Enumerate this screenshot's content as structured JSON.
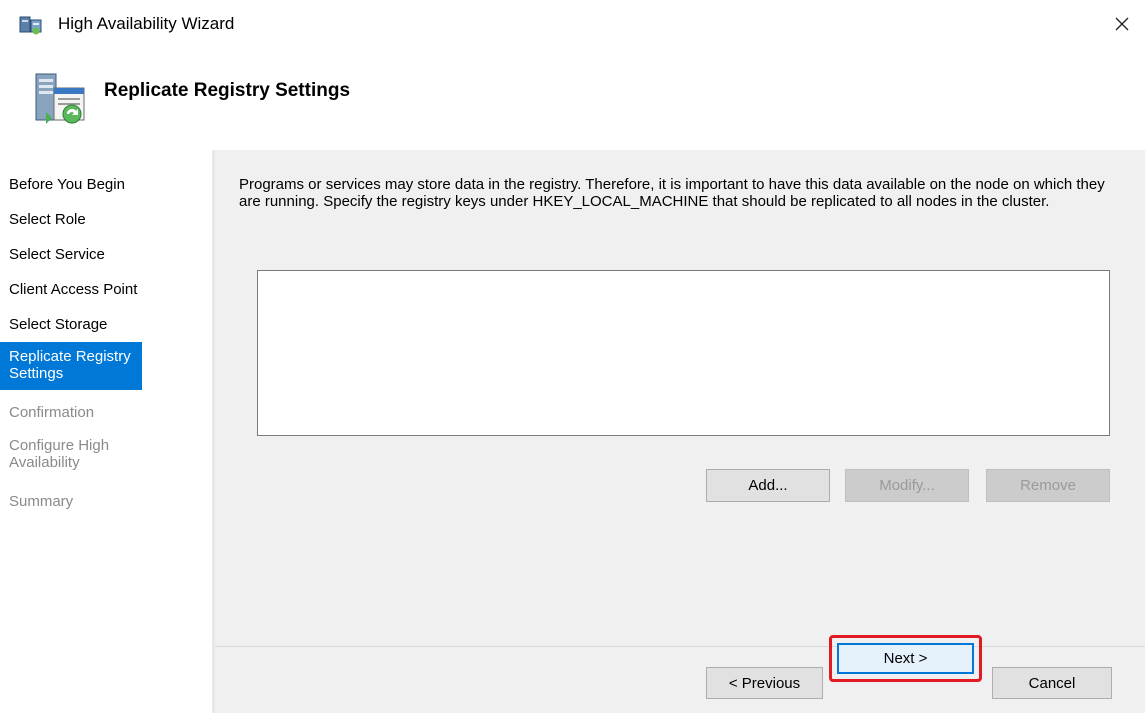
{
  "window": {
    "title": "High Availability Wizard",
    "close_symbol": "×"
  },
  "header": {
    "title": "Replicate Registry Settings",
    "icon": "server-registry-icon"
  },
  "sidebar": {
    "items": [
      {
        "label": "Before You Begin",
        "state": "done"
      },
      {
        "label": "Select Role",
        "state": "done"
      },
      {
        "label": "Select Service",
        "state": "done"
      },
      {
        "label": "Client Access Point",
        "state": "done"
      },
      {
        "label": "Select Storage",
        "state": "done"
      },
      {
        "label": "Replicate Registry Settings",
        "state": "active"
      },
      {
        "label": "Confirmation",
        "state": "pending"
      },
      {
        "label": "Configure High Availability",
        "state": "pending"
      },
      {
        "label": "Summary",
        "state": "pending"
      }
    ]
  },
  "main": {
    "description": "Programs or services may store data in the registry.  Therefore, it is important to have this data available on the node on which they are running.  Specify the registry keys under HKEY_LOCAL_MACHINE that should be replicated to all nodes in the cluster.",
    "registry_keys": [],
    "add_label": "Add...",
    "modify_label": "Modify...",
    "remove_label": "Remove"
  },
  "footer": {
    "previous_label": "< Previous",
    "next_label": "Next >",
    "cancel_label": "Cancel"
  },
  "colors": {
    "accent": "#0078d7",
    "highlight_outline": "#e01b24",
    "panel": "#f0f0f0"
  }
}
